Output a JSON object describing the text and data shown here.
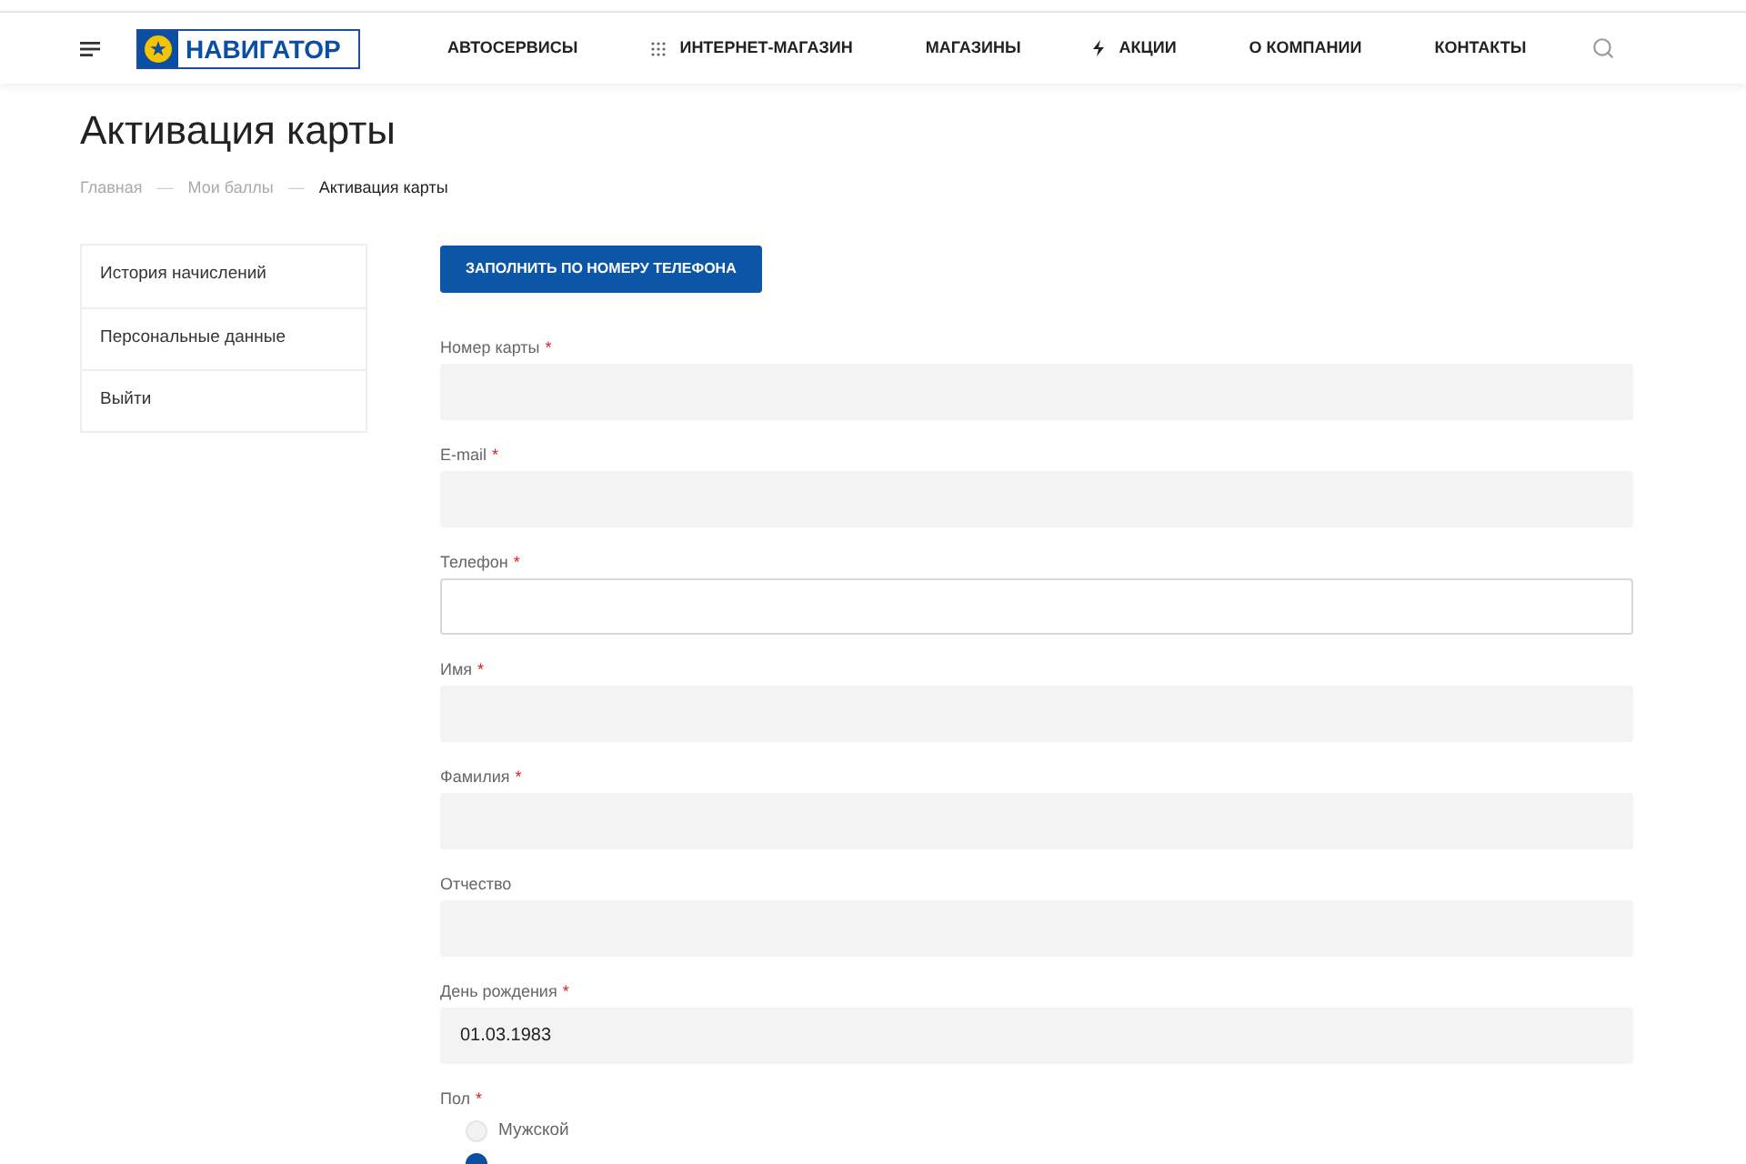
{
  "header": {
    "logo": "НАВИГАТОР",
    "nav": [
      {
        "label": "АВТОСЕРВИСЫ",
        "kind": "plain"
      },
      {
        "label": "ИНТЕРНЕТ-МАГАЗИН",
        "kind": "grid"
      },
      {
        "label": "МАГАЗИНЫ",
        "kind": "plain"
      },
      {
        "label": "АКЦИИ",
        "kind": "bolt"
      },
      {
        "label": "О КОМПАНИИ",
        "kind": "plain"
      },
      {
        "label": "КОНТАКТЫ",
        "kind": "plain"
      }
    ]
  },
  "page_title": "Активация карты",
  "breadcrumbs": [
    {
      "label": "Главная",
      "current": false
    },
    {
      "label": "Мои баллы",
      "current": false
    },
    {
      "label": "Активация карты",
      "current": true
    }
  ],
  "breadcrumb_separator": "—",
  "sidebar": {
    "items": [
      "История начислений",
      "Персональные данные",
      "Выйти"
    ]
  },
  "fill_button": "ЗАПОЛНИТЬ ПО НОМЕРУ ТЕЛЕФОНА",
  "fields": [
    {
      "label": "Номер карты",
      "required_mark": "*",
      "focused": false
    },
    {
      "label": "E-mail",
      "required_mark": "*",
      "focused": false
    },
    {
      "label": "Телефон",
      "required_mark": "*",
      "focused": true
    },
    {
      "label": "Имя",
      "required_mark": "*",
      "focused": false
    },
    {
      "label": "Фамилия",
      "required_mark": "*",
      "focused": false
    },
    {
      "label": "Отчество",
      "focused": false
    },
    {
      "label": "День рождения",
      "required_mark": "*",
      "value": "01.03.1983",
      "focused": false
    }
  ],
  "gender": {
    "label": "Пол",
    "required_mark": "*",
    "options": [
      {
        "label": "Мужской",
        "selected": false
      },
      {
        "selected": true
      }
    ]
  }
}
